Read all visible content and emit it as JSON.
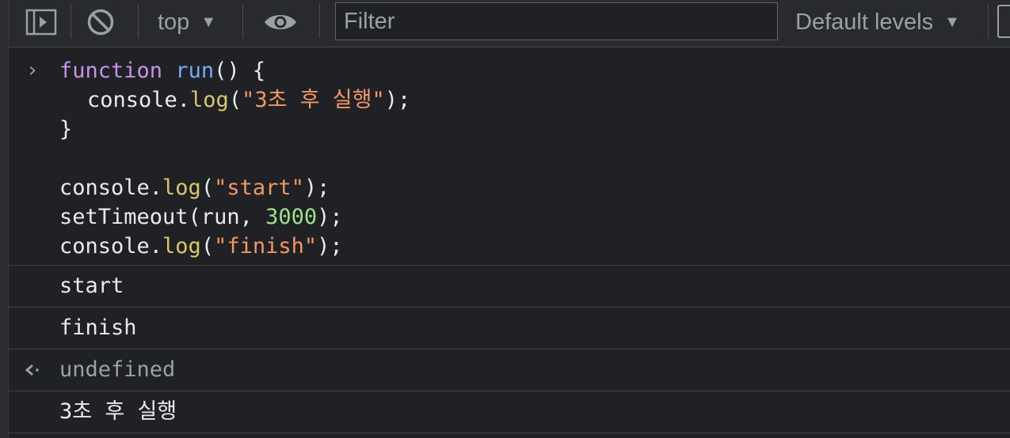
{
  "toolbar": {
    "sidebar_icon": "sidebar-toggle-icon",
    "clear_icon": "clear-console-icon",
    "context": "top",
    "eye_icon": "eye-icon",
    "filter_placeholder": "Filter",
    "levels": "Default levels",
    "caret": "▼"
  },
  "input": {
    "prompt_icon": "chevron-right-icon",
    "lines": [
      {
        "kw": "function",
        "fn": "run",
        "rest": "() {"
      },
      {
        "obj": "console.",
        "method": "log",
        "open": "(",
        "str": "\"3초 후 실행\"",
        "close": ");"
      },
      {
        "text": "}"
      },
      {
        "obj": "console.",
        "method": "log",
        "open": "(",
        "str": "\"start\"",
        "close": ");"
      },
      {
        "call": "setTimeout(run, ",
        "num": "3000",
        "close": ");"
      },
      {
        "obj": "console.",
        "method": "log",
        "open": "(",
        "str": "\"finish\"",
        "close": ");"
      }
    ]
  },
  "outputs": {
    "log1": "start",
    "log2": "finish",
    "return_icon": "return-arrow-icon",
    "return_value": "undefined",
    "log3": "3초 후 실행"
  },
  "colors": {
    "background": "#202124",
    "keyword": "#c792ea",
    "function_name": "#78a9ff",
    "method": "#d9c76d",
    "string": "#f29766",
    "number": "#9be38a"
  }
}
